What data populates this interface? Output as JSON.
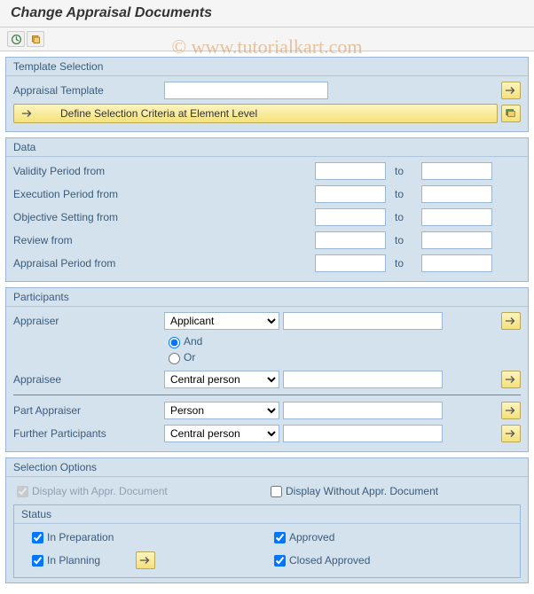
{
  "title": "Change Appraisal Documents",
  "watermark": "© www.tutorialkart.com",
  "template_selection": {
    "heading": "Template Selection",
    "appraisal_template_label": "Appraisal Template",
    "define_criteria_label": "Define Selection Criteria at Element Level"
  },
  "data_section": {
    "heading": "Data",
    "to_label": "to",
    "rows": [
      {
        "label": "Validity Period from"
      },
      {
        "label": "Execution Period from"
      },
      {
        "label": "Objective Setting from"
      },
      {
        "label": "Review from"
      },
      {
        "label": "Appraisal Period from"
      }
    ]
  },
  "participants": {
    "heading": "Participants",
    "appraiser_label": "Appraiser",
    "appraiser_value": "Applicant",
    "and_label": "And",
    "or_label": "Or",
    "appraisee_label": "Appraisee",
    "appraisee_value": "Central person",
    "part_appraiser_label": "Part Appraiser",
    "part_appraiser_value": "Person",
    "further_label": "Further Participants",
    "further_value": "Central person"
  },
  "selection_options": {
    "heading": "Selection Options",
    "display_with": "Display with Appr. Document",
    "display_without": "Display Without Appr. Document",
    "status_heading": "Status",
    "in_preparation": "In Preparation",
    "in_planning": "In Planning",
    "approved": "Approved",
    "closed_approved": "Closed Approved"
  }
}
